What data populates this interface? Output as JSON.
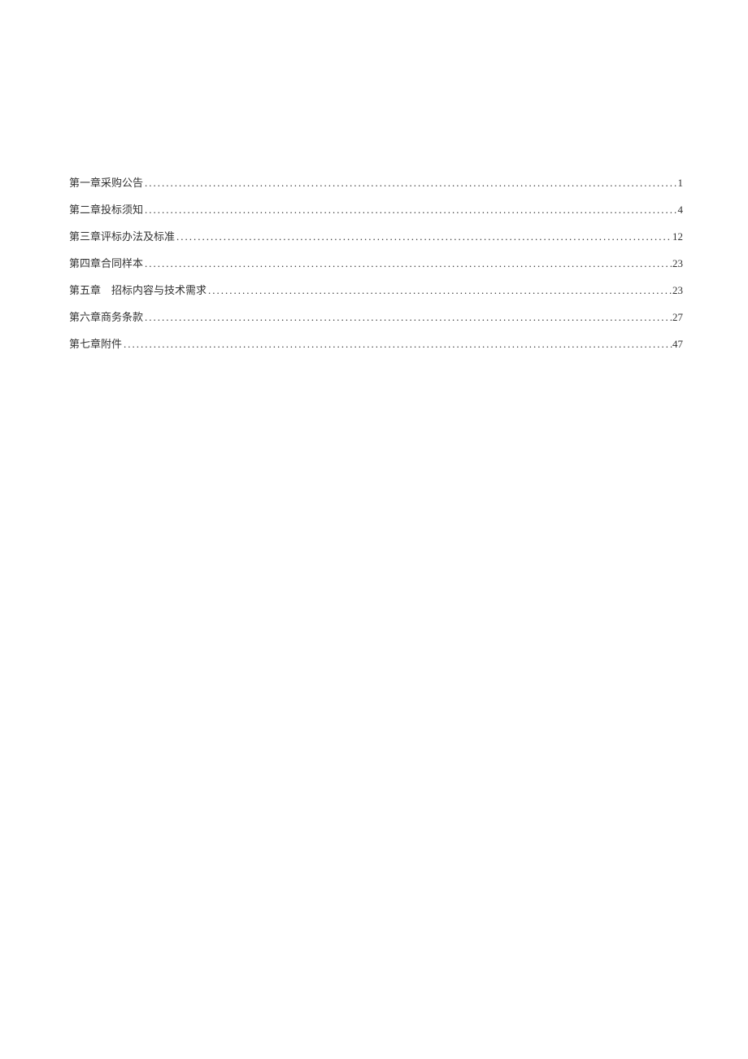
{
  "toc": {
    "entries": [
      {
        "title": "第一章采购公告",
        "page": "1"
      },
      {
        "title": "第二章投标须知",
        "page": "4"
      },
      {
        "title": "第三章评标办法及标准",
        "page": "12"
      },
      {
        "title": "第四章合同样本",
        "page": "23"
      },
      {
        "title": "第五章　招标内容与技术需求",
        "page": "23"
      },
      {
        "title": "第六章商务条款",
        "page": "27"
      },
      {
        "title": "第七章附件",
        "page": "47"
      }
    ]
  }
}
